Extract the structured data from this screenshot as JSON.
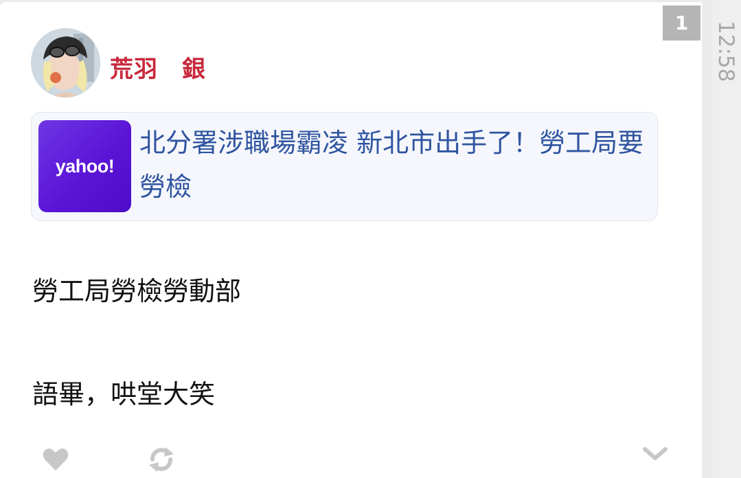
{
  "post": {
    "badge_number": "1",
    "time": "12:58",
    "author": "荒羽　銀",
    "link": {
      "source_logo": "yahoo!",
      "title": "北分署涉職場霸凌 新北市出手了！勞工局要勞檢"
    },
    "lines": [
      "勞工局勞檢勞動部",
      "語畢，哄堂大笑"
    ],
    "actions": {
      "like": "heart-icon",
      "repost": "repost-icon",
      "more": "chevron-down-icon"
    },
    "colors": {
      "author": "#c8283c",
      "link_title": "#2f54a0",
      "yahoo_purple": "#5f1ad8",
      "badge": "#b5b5b5",
      "icon_gray": "#c7c7c7"
    }
  }
}
